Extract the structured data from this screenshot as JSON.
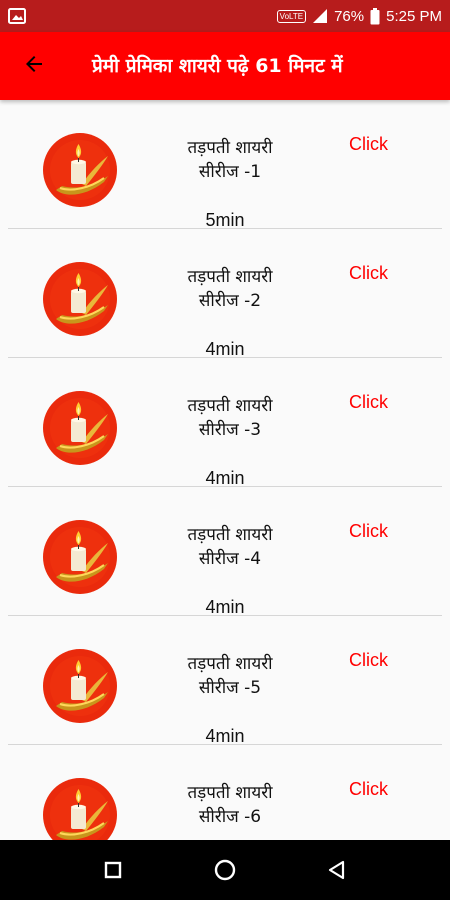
{
  "status_bar": {
    "network_label": "VoLTE",
    "battery": "76%",
    "time": "5:25 PM",
    "icons": [
      "gallery-icon",
      "signal-icon",
      "battery-icon"
    ]
  },
  "app_bar": {
    "title": "प्रेमी प्रेमिका शायरी पढ़े 61 मिनट में",
    "back_icon": "arrow-left-icon",
    "color": "#ff0000"
  },
  "items": [
    {
      "line1": "तड़पती शायरी",
      "line2": "सीरीज -1",
      "action": "Click",
      "duration": "5min"
    },
    {
      "line1": "तड़पती शायरी",
      "line2": "सीरीज -2",
      "action": "Click",
      "duration": "4min"
    },
    {
      "line1": "तड़पती शायरी",
      "line2": "सीरीज -3",
      "action": "Click",
      "duration": "4min"
    },
    {
      "line1": "तड़पती शायरी",
      "line2": "सीरीज -4",
      "action": "Click",
      "duration": "4min"
    },
    {
      "line1": "तड़पती शायरी",
      "line2": "सीरीज -5",
      "action": "Click",
      "duration": "4min"
    },
    {
      "line1": "तड़पती शायरी",
      "line2": "सीरीज -6",
      "action": "Click",
      "duration": ""
    }
  ],
  "nav_bar": {
    "buttons": [
      "recents-square-icon",
      "home-circle-icon",
      "back-triangle-icon"
    ]
  }
}
